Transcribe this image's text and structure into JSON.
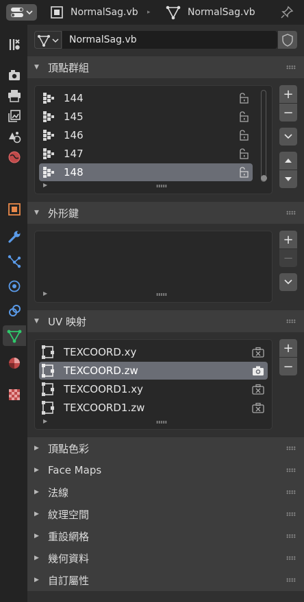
{
  "topbar": {
    "breadcrumb_object": "NormalSag.vb",
    "breadcrumb_mesh": "NormalSag.vb"
  },
  "datablock": {
    "name": "NormalSag.vb"
  },
  "vertex_groups": {
    "title": "頂點群組",
    "items": [
      {
        "label": "144"
      },
      {
        "label": "145"
      },
      {
        "label": "146"
      },
      {
        "label": "147"
      },
      {
        "label": "148"
      }
    ],
    "selected_index": 4
  },
  "shape_keys": {
    "title": "外形鍵"
  },
  "uv_maps": {
    "title": "UV 映射",
    "items": [
      {
        "label": "TEXCOORD.xy"
      },
      {
        "label": "TEXCOORD.zw"
      },
      {
        "label": "TEXCOORD1.xy"
      },
      {
        "label": "TEXCOORD1.zw"
      }
    ],
    "selected_index": 1
  },
  "collapsed_panels": [
    {
      "label": "頂點色彩"
    },
    {
      "label": "Face Maps"
    },
    {
      "label": "法線"
    },
    {
      "label": "紋理空間"
    },
    {
      "label": "重設網格"
    },
    {
      "label": "幾何資料"
    },
    {
      "label": "自訂屬性"
    }
  ],
  "icons": {
    "tabs": [
      "tool-icon",
      "render-icon",
      "output-icon",
      "view-layer-icon",
      "scene-icon",
      "world-icon",
      "object-icon",
      "modifier-icon",
      "particles-icon",
      "physics-icon",
      "constraints-icon",
      "mesh-data-icon",
      "material-icon",
      "texture-icon"
    ]
  },
  "colors": {
    "accent_green": "#2fc86b",
    "selected_row": "#6a6d75",
    "object_orange": "#e8884a"
  }
}
